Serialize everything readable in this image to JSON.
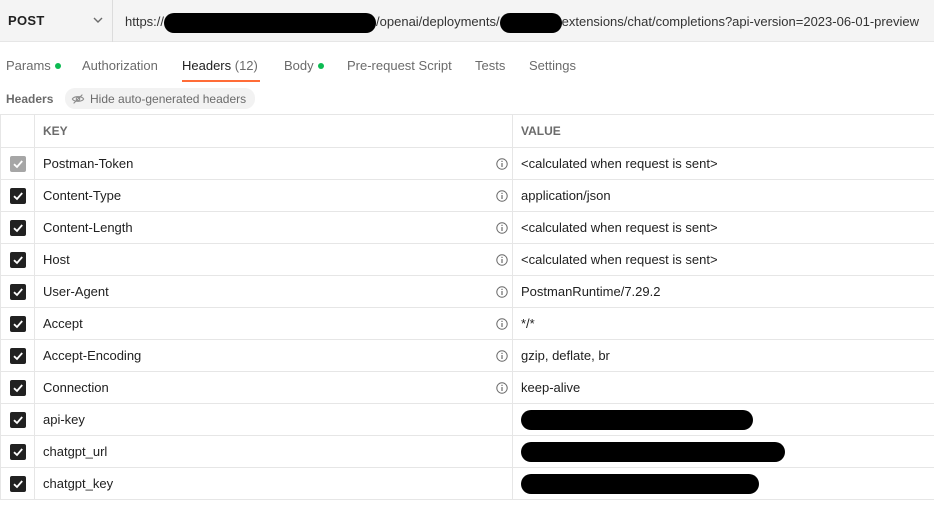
{
  "request": {
    "method": "POST",
    "url_parts": [
      {
        "text": "https://",
        "redacted": false
      },
      {
        "text": "",
        "redacted": true,
        "w": 212
      },
      {
        "text": "/openai/deployments/",
        "redacted": false
      },
      {
        "text": "",
        "redacted": true,
        "w": 62
      },
      {
        "text": "extensions/chat/completions?api-version=2023-06-01-preview",
        "redacted": false
      }
    ]
  },
  "tabs": [
    {
      "label": "Params",
      "dot": true
    },
    {
      "label": "Authorization",
      "dot": false
    },
    {
      "label": "Headers",
      "count": "(12)",
      "active": true
    },
    {
      "label": "Body",
      "dot": true
    },
    {
      "label": "Pre-request Script",
      "dot": false
    },
    {
      "label": "Tests",
      "dot": false
    },
    {
      "label": "Settings",
      "dot": false
    }
  ],
  "subbar": {
    "title": "Headers",
    "hide_button": "Hide auto-generated headers"
  },
  "table": {
    "key_header": "KEY",
    "value_header": "VALUE",
    "rows": [
      {
        "key": "Postman-Token",
        "value": "<calculated when request is sent>",
        "info": true,
        "checked_disabled": true
      },
      {
        "key": "Content-Type",
        "value": "application/json",
        "info": true
      },
      {
        "key": "Content-Length",
        "value": "<calculated when request is sent>",
        "info": true
      },
      {
        "key": "Host",
        "value": "<calculated when request is sent>",
        "info": true
      },
      {
        "key": "User-Agent",
        "value": "PostmanRuntime/7.29.2",
        "info": true
      },
      {
        "key": "Accept",
        "value": "*/*",
        "info": true
      },
      {
        "key": "Accept-Encoding",
        "value": "gzip, deflate, br",
        "info": true
      },
      {
        "key": "Connection",
        "value": "keep-alive",
        "info": true
      },
      {
        "key": "api-key",
        "value": "",
        "redacted": true,
        "info": false
      },
      {
        "key": "chatgpt_url",
        "value": "",
        "redacted": true,
        "info": false
      },
      {
        "key": "chatgpt_key",
        "value": "",
        "redacted": true,
        "info": false
      }
    ]
  },
  "colors": {
    "accent": "#ff6c37",
    "dot": "#0cbb52"
  }
}
